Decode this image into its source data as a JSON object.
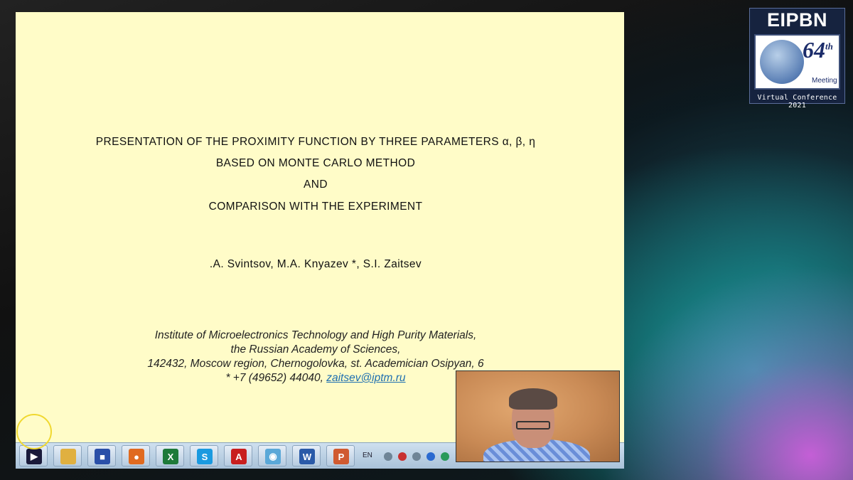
{
  "slide": {
    "title_lines": [
      "PRESENTATION OF THE PROXIMITY FUNCTION BY THREE PARAMETERS α, β, η",
      "BASED ON MONTE CARLO METHOD",
      "AND",
      "COMPARISON WITH THE EXPERIMENT"
    ],
    "authors": ".A. Svintsov, M.A. Knyazev *, S.I. Zaitsev",
    "affiliation": {
      "line1": "Institute of Microelectronics Technology and High Purity Materials,",
      "line2": "the Russian Academy of Sciences,",
      "line3": "142432, Moscow region, Chernogolovka, st. Academician Osipyan, 6",
      "line4_prefix": "* +7 (49652) 44040, ",
      "email": "zaitsev@iptm.ru"
    }
  },
  "taskbar": {
    "apps": [
      {
        "icon": "media-player-icon",
        "color": "#1a1a3a",
        "glyph": "▶"
      },
      {
        "icon": "file-explorer-icon",
        "color": "#e0b040",
        "glyph": ""
      },
      {
        "icon": "floppy-save-icon",
        "color": "#2a4fa8",
        "glyph": "■"
      },
      {
        "icon": "firefox-icon",
        "color": "#e06a20",
        "glyph": "●"
      },
      {
        "icon": "excel-icon",
        "color": "#1e7a3a",
        "glyph": "X"
      },
      {
        "icon": "skype-icon",
        "color": "#1a9ae0",
        "glyph": "S"
      },
      {
        "icon": "acrobat-icon",
        "color": "#c81e1e",
        "glyph": "A"
      },
      {
        "icon": "disc-icon",
        "color": "#5aa8d8",
        "glyph": "◉"
      },
      {
        "icon": "word-icon",
        "color": "#2a5aa8",
        "glyph": "W"
      },
      {
        "icon": "powerpoint-icon",
        "color": "#d05a30",
        "glyph": "P"
      }
    ],
    "language": "EN"
  },
  "logo": {
    "title": "EIPBN",
    "number": "64",
    "suffix": "th",
    "meeting": "Meeting",
    "footer": "Virtual Conference 2021"
  }
}
